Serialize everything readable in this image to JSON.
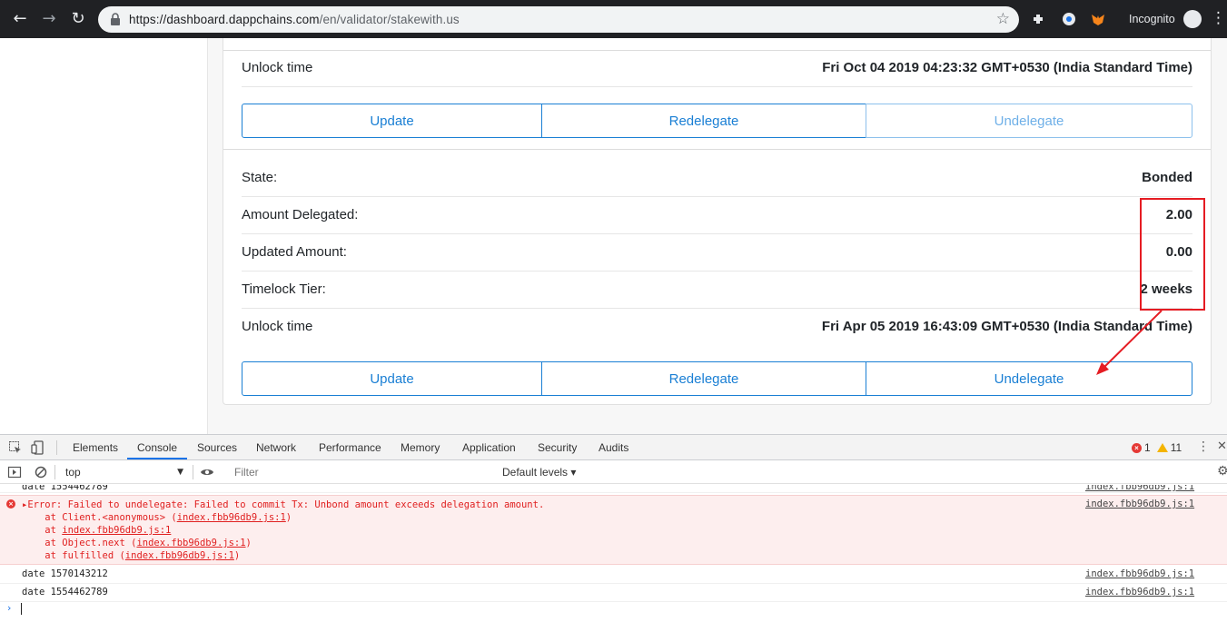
{
  "browser": {
    "url_host": "https://dashboard.dappchains.com",
    "url_path": "/en/validator/stakewith.us",
    "incognito_label": "Incognito"
  },
  "delegations": [
    {
      "unlock_label": "Unlock time",
      "unlock_value": "Fri Oct 04 2019 04:23:32 GMT+0530 (India Standard Time)",
      "buttons": {
        "update": "Update",
        "redelegate": "Redelegate",
        "undelegate": "Undelegate"
      }
    },
    {
      "rows": [
        {
          "label": "State:",
          "value": "Bonded"
        },
        {
          "label": "Amount Delegated:",
          "value": "2.00"
        },
        {
          "label": "Updated Amount:",
          "value": "0.00"
        },
        {
          "label": "Timelock Tier:",
          "value": "2 weeks"
        },
        {
          "label": "Unlock time",
          "value": "Fri Apr 05 2019 16:43:09 GMT+0530 (India Standard Time)"
        }
      ],
      "buttons": {
        "update": "Update",
        "redelegate": "Redelegate",
        "undelegate": "Undelegate"
      }
    }
  ],
  "devtools": {
    "tabs": [
      "Elements",
      "Console",
      "Sources",
      "Network",
      "Performance",
      "Memory",
      "Application",
      "Security",
      "Audits"
    ],
    "active_tab": "Console",
    "error_count": "1",
    "warning_count": "11",
    "context": "top",
    "filter_placeholder": "Filter",
    "levels": "Default levels ▾",
    "console": {
      "line0": "date 1554462789",
      "error_line": "▸Error: Failed to undelegate: Failed to commit Tx: Unbond amount exceeds delegation amount.",
      "stack": [
        {
          "prefix": "    at Client.<anonymous> (",
          "link": "index.fbb96db9.js:1",
          "suffix": ")"
        },
        {
          "prefix": "    at ",
          "link": "index.fbb96db9.js:1",
          "suffix": ""
        },
        {
          "prefix": "    at Object.next (",
          "link": "index.fbb96db9.js:1",
          "suffix": ")"
        },
        {
          "prefix": "    at fulfilled (",
          "link": "index.fbb96db9.js:1",
          "suffix": ")"
        }
      ],
      "line2": "date 1570143212",
      "line3": "date 1554462789",
      "source": "index.fbb96db9.js:1",
      "prompt": "›"
    }
  },
  "colors": {
    "accent": "#1a7fd4",
    "annotation": "#e51c23",
    "error_bg": "#fdeeee"
  }
}
